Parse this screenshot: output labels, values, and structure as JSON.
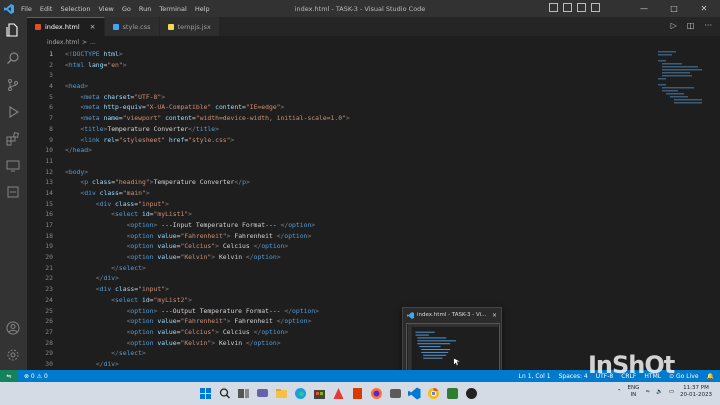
{
  "titlebar": {
    "menu": [
      "File",
      "Edit",
      "Selection",
      "View",
      "Go",
      "Run",
      "Terminal",
      "Help"
    ],
    "title": "index.html - TASK-3 - Visual Studio Code"
  },
  "tabs": [
    {
      "label": "index.html",
      "close": "×",
      "color": "#e44d26"
    },
    {
      "label": "style.css",
      "close": "",
      "color": "#42a5f5"
    },
    {
      "label": "tempjs.jsx",
      "close": "",
      "color": "#f0db4f"
    }
  ],
  "breadcrumb": [
    "index.html",
    ">",
    "..."
  ],
  "code": [
    {
      "n": "1",
      "t": [
        [
          "br",
          "<!"
        ],
        [
          "doc",
          "DOCTYPE"
        ],
        [
          "at",
          " html"
        ],
        [
          "br",
          ">"
        ]
      ]
    },
    {
      "n": "2",
      "t": [
        [
          "br",
          "<"
        ],
        [
          "tag",
          "html"
        ],
        [
          "at",
          " lang"
        ],
        [
          "tx",
          "="
        ],
        [
          "st",
          "\"en\""
        ],
        [
          "br",
          ">"
        ]
      ]
    },
    {
      "n": "3",
      "t": []
    },
    {
      "n": "4",
      "t": [
        [
          "br",
          "<"
        ],
        [
          "tag",
          "head"
        ],
        [
          "br",
          ">"
        ]
      ]
    },
    {
      "n": "5",
      "t": [
        [
          "tx",
          "    "
        ],
        [
          "br",
          "<"
        ],
        [
          "tag",
          "meta"
        ],
        [
          "at",
          " charset"
        ],
        [
          "tx",
          "="
        ],
        [
          "st",
          "\"UTF-8\""
        ],
        [
          "br",
          ">"
        ]
      ]
    },
    {
      "n": "6",
      "t": [
        [
          "tx",
          "    "
        ],
        [
          "br",
          "<"
        ],
        [
          "tag",
          "meta"
        ],
        [
          "at",
          " http-equiv"
        ],
        [
          "tx",
          "="
        ],
        [
          "st",
          "\"X-UA-Compatible\""
        ],
        [
          "at",
          " content"
        ],
        [
          "tx",
          "="
        ],
        [
          "st",
          "\"IE=edge\""
        ],
        [
          "br",
          ">"
        ]
      ]
    },
    {
      "n": "7",
      "t": [
        [
          "tx",
          "    "
        ],
        [
          "br",
          "<"
        ],
        [
          "tag",
          "meta"
        ],
        [
          "at",
          " name"
        ],
        [
          "tx",
          "="
        ],
        [
          "st",
          "\"viewport\""
        ],
        [
          "at",
          " content"
        ],
        [
          "tx",
          "="
        ],
        [
          "st",
          "\"width=device-width, initial-scale=1.0\""
        ],
        [
          "br",
          ">"
        ]
      ]
    },
    {
      "n": "8",
      "t": [
        [
          "tx",
          "    "
        ],
        [
          "br",
          "<"
        ],
        [
          "tag",
          "title"
        ],
        [
          "br",
          ">"
        ],
        [
          "tx",
          "Temperature Converter"
        ],
        [
          "br",
          "</"
        ],
        [
          "tag",
          "title"
        ],
        [
          "br",
          ">"
        ]
      ]
    },
    {
      "n": "9",
      "t": [
        [
          "tx",
          "    "
        ],
        [
          "br",
          "<"
        ],
        [
          "tag",
          "link"
        ],
        [
          "at",
          " rel"
        ],
        [
          "tx",
          "="
        ],
        [
          "st",
          "\"stylesheet\""
        ],
        [
          "at",
          " href"
        ],
        [
          "tx",
          "="
        ],
        [
          "st",
          "\"style.css\""
        ],
        [
          "br",
          ">"
        ]
      ]
    },
    {
      "n": "10",
      "t": [
        [
          "br",
          "</"
        ],
        [
          "tag",
          "head"
        ],
        [
          "br",
          ">"
        ]
      ]
    },
    {
      "n": "11",
      "t": []
    },
    {
      "n": "12",
      "t": [
        [
          "br",
          "<"
        ],
        [
          "tag",
          "body"
        ],
        [
          "br",
          ">"
        ]
      ]
    },
    {
      "n": "13",
      "t": [
        [
          "tx",
          "    "
        ],
        [
          "br",
          "<"
        ],
        [
          "tag",
          "p"
        ],
        [
          "at",
          " class"
        ],
        [
          "tx",
          "="
        ],
        [
          "st",
          "\"heading\""
        ],
        [
          "br",
          ">"
        ],
        [
          "tx",
          "Temperature Converter"
        ],
        [
          "br",
          "</"
        ],
        [
          "tag",
          "p"
        ],
        [
          "br",
          ">"
        ]
      ]
    },
    {
      "n": "14",
      "t": [
        [
          "tx",
          "    "
        ],
        [
          "br",
          "<"
        ],
        [
          "tag",
          "div"
        ],
        [
          "at",
          " class"
        ],
        [
          "tx",
          "="
        ],
        [
          "st",
          "\"main\""
        ],
        [
          "br",
          ">"
        ]
      ]
    },
    {
      "n": "15",
      "t": [
        [
          "tx",
          "        "
        ],
        [
          "br",
          "<"
        ],
        [
          "tag",
          "div"
        ],
        [
          "at",
          " class"
        ],
        [
          "tx",
          "="
        ],
        [
          "st",
          "\"input\""
        ],
        [
          "br",
          ">"
        ]
      ]
    },
    {
      "n": "16",
      "t": [
        [
          "tx",
          "            "
        ],
        [
          "br",
          "<"
        ],
        [
          "tag",
          "select"
        ],
        [
          "at",
          " id"
        ],
        [
          "tx",
          "="
        ],
        [
          "st",
          "\"myList1\""
        ],
        [
          "br",
          ">"
        ]
      ]
    },
    {
      "n": "17",
      "t": [
        [
          "tx",
          "                "
        ],
        [
          "br",
          "<"
        ],
        [
          "tag",
          "option"
        ],
        [
          "br",
          ">"
        ],
        [
          "tx",
          " ---Input Temperature Format--- "
        ],
        [
          "br",
          "</"
        ],
        [
          "tag",
          "option"
        ],
        [
          "br",
          ">"
        ]
      ]
    },
    {
      "n": "18",
      "t": [
        [
          "tx",
          "                "
        ],
        [
          "br",
          "<"
        ],
        [
          "tag",
          "option"
        ],
        [
          "at",
          " value"
        ],
        [
          "tx",
          "="
        ],
        [
          "st",
          "\"Fahrenheit\""
        ],
        [
          "br",
          ">"
        ],
        [
          "tx",
          " Fahrenheit "
        ],
        [
          "br",
          "</"
        ],
        [
          "tag",
          "option"
        ],
        [
          "br",
          ">"
        ]
      ]
    },
    {
      "n": "19",
      "t": [
        [
          "tx",
          "                "
        ],
        [
          "br",
          "<"
        ],
        [
          "tag",
          "option"
        ],
        [
          "at",
          " value"
        ],
        [
          "tx",
          "="
        ],
        [
          "st",
          "\"Celcius\""
        ],
        [
          "br",
          ">"
        ],
        [
          "tx",
          " Celcius "
        ],
        [
          "br",
          "</"
        ],
        [
          "tag",
          "option"
        ],
        [
          "br",
          ">"
        ]
      ]
    },
    {
      "n": "20",
      "t": [
        [
          "tx",
          "                "
        ],
        [
          "br",
          "<"
        ],
        [
          "tag",
          "option"
        ],
        [
          "at",
          " value"
        ],
        [
          "tx",
          "="
        ],
        [
          "st",
          "\"Kelvin\""
        ],
        [
          "br",
          ">"
        ],
        [
          "tx",
          " Kelvin "
        ],
        [
          "br",
          "</"
        ],
        [
          "tag",
          "option"
        ],
        [
          "br",
          ">"
        ]
      ]
    },
    {
      "n": "21",
      "t": [
        [
          "tx",
          "            "
        ],
        [
          "br",
          "</"
        ],
        [
          "tag",
          "select"
        ],
        [
          "br",
          ">"
        ]
      ]
    },
    {
      "n": "22",
      "t": [
        [
          "tx",
          "        "
        ],
        [
          "br",
          "</"
        ],
        [
          "tag",
          "div"
        ],
        [
          "br",
          ">"
        ]
      ]
    },
    {
      "n": "23",
      "t": [
        [
          "tx",
          "        "
        ],
        [
          "br",
          "<"
        ],
        [
          "tag",
          "div"
        ],
        [
          "at",
          " class"
        ],
        [
          "tx",
          "="
        ],
        [
          "st",
          "\"input\""
        ],
        [
          "br",
          ">"
        ]
      ]
    },
    {
      "n": "24",
      "t": [
        [
          "tx",
          "            "
        ],
        [
          "br",
          "<"
        ],
        [
          "tag",
          "select"
        ],
        [
          "at",
          " id"
        ],
        [
          "tx",
          "="
        ],
        [
          "st",
          "\"myList2\""
        ],
        [
          "br",
          ">"
        ]
      ]
    },
    {
      "n": "25",
      "t": [
        [
          "tx",
          "                "
        ],
        [
          "br",
          "<"
        ],
        [
          "tag",
          "option"
        ],
        [
          "br",
          ">"
        ],
        [
          "tx",
          " ---Output Temperature Format--- "
        ],
        [
          "br",
          "</"
        ],
        [
          "tag",
          "option"
        ],
        [
          "br",
          ">"
        ]
      ]
    },
    {
      "n": "26",
      "t": [
        [
          "tx",
          "                "
        ],
        [
          "br",
          "<"
        ],
        [
          "tag",
          "option"
        ],
        [
          "at",
          " value"
        ],
        [
          "tx",
          "="
        ],
        [
          "st",
          "\"Fahrenheit\""
        ],
        [
          "br",
          ">"
        ],
        [
          "tx",
          " Fahrenheit "
        ],
        [
          "br",
          "</"
        ],
        [
          "tag",
          "option"
        ],
        [
          "br",
          ">"
        ]
      ]
    },
    {
      "n": "27",
      "t": [
        [
          "tx",
          "                "
        ],
        [
          "br",
          "<"
        ],
        [
          "tag",
          "option"
        ],
        [
          "at",
          " value"
        ],
        [
          "tx",
          "="
        ],
        [
          "st",
          "\"Celcius\""
        ],
        [
          "br",
          ">"
        ],
        [
          "tx",
          " Celcius "
        ],
        [
          "br",
          "</"
        ],
        [
          "tag",
          "option"
        ],
        [
          "br",
          ">"
        ]
      ]
    },
    {
      "n": "28",
      "t": [
        [
          "tx",
          "                "
        ],
        [
          "br",
          "<"
        ],
        [
          "tag",
          "option"
        ],
        [
          "at",
          " value"
        ],
        [
          "tx",
          "="
        ],
        [
          "st",
          "\"Kelvin\""
        ],
        [
          "br",
          ">"
        ],
        [
          "tx",
          " Kelvin "
        ],
        [
          "br",
          "</"
        ],
        [
          "tag",
          "option"
        ],
        [
          "br",
          ">"
        ]
      ]
    },
    {
      "n": "29",
      "t": [
        [
          "tx",
          "            "
        ],
        [
          "br",
          "</"
        ],
        [
          "tag",
          "select"
        ],
        [
          "br",
          ">"
        ]
      ]
    },
    {
      "n": "30",
      "t": [
        [
          "tx",
          "        "
        ],
        [
          "br",
          "</"
        ],
        [
          "tag",
          "div"
        ],
        [
          "br",
          ">"
        ]
      ]
    }
  ],
  "status": {
    "errors": "⊗ 0 ⚠ 0",
    "cursor": "Ln 1, Col 1",
    "spaces": "Spaces: 4",
    "encoding": "UTF-8",
    "eol": "CRLF",
    "lang": "HTML",
    "golive": "⊙ Go Live"
  },
  "thumbnail": {
    "title": "index.html - TASK-3 - Vi...",
    "close": "×"
  },
  "tray": {
    "lang1": "ENG",
    "lang2": "IN",
    "time": "11:37 PM",
    "date": "20-01-2023"
  },
  "watermark": "InShOt"
}
